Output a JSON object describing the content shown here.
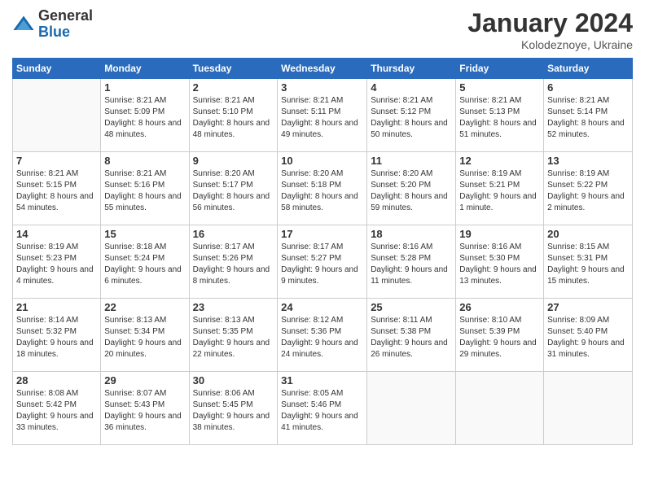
{
  "logo": {
    "general": "General",
    "blue": "Blue"
  },
  "header": {
    "month": "January 2024",
    "location": "Kolodeznoye, Ukraine"
  },
  "days_of_week": [
    "Sunday",
    "Monday",
    "Tuesday",
    "Wednesday",
    "Thursday",
    "Friday",
    "Saturday"
  ],
  "weeks": [
    [
      {
        "num": "",
        "sunrise": "",
        "sunset": "",
        "daylight": ""
      },
      {
        "num": "1",
        "sunrise": "Sunrise: 8:21 AM",
        "sunset": "Sunset: 5:09 PM",
        "daylight": "Daylight: 8 hours and 48 minutes."
      },
      {
        "num": "2",
        "sunrise": "Sunrise: 8:21 AM",
        "sunset": "Sunset: 5:10 PM",
        "daylight": "Daylight: 8 hours and 48 minutes."
      },
      {
        "num": "3",
        "sunrise": "Sunrise: 8:21 AM",
        "sunset": "Sunset: 5:11 PM",
        "daylight": "Daylight: 8 hours and 49 minutes."
      },
      {
        "num": "4",
        "sunrise": "Sunrise: 8:21 AM",
        "sunset": "Sunset: 5:12 PM",
        "daylight": "Daylight: 8 hours and 50 minutes."
      },
      {
        "num": "5",
        "sunrise": "Sunrise: 8:21 AM",
        "sunset": "Sunset: 5:13 PM",
        "daylight": "Daylight: 8 hours and 51 minutes."
      },
      {
        "num": "6",
        "sunrise": "Sunrise: 8:21 AM",
        "sunset": "Sunset: 5:14 PM",
        "daylight": "Daylight: 8 hours and 52 minutes."
      }
    ],
    [
      {
        "num": "7",
        "sunrise": "Sunrise: 8:21 AM",
        "sunset": "Sunset: 5:15 PM",
        "daylight": "Daylight: 8 hours and 54 minutes."
      },
      {
        "num": "8",
        "sunrise": "Sunrise: 8:21 AM",
        "sunset": "Sunset: 5:16 PM",
        "daylight": "Daylight: 8 hours and 55 minutes."
      },
      {
        "num": "9",
        "sunrise": "Sunrise: 8:20 AM",
        "sunset": "Sunset: 5:17 PM",
        "daylight": "Daylight: 8 hours and 56 minutes."
      },
      {
        "num": "10",
        "sunrise": "Sunrise: 8:20 AM",
        "sunset": "Sunset: 5:18 PM",
        "daylight": "Daylight: 8 hours and 58 minutes."
      },
      {
        "num": "11",
        "sunrise": "Sunrise: 8:20 AM",
        "sunset": "Sunset: 5:20 PM",
        "daylight": "Daylight: 8 hours and 59 minutes."
      },
      {
        "num": "12",
        "sunrise": "Sunrise: 8:19 AM",
        "sunset": "Sunset: 5:21 PM",
        "daylight": "Daylight: 9 hours and 1 minute."
      },
      {
        "num": "13",
        "sunrise": "Sunrise: 8:19 AM",
        "sunset": "Sunset: 5:22 PM",
        "daylight": "Daylight: 9 hours and 2 minutes."
      }
    ],
    [
      {
        "num": "14",
        "sunrise": "Sunrise: 8:19 AM",
        "sunset": "Sunset: 5:23 PM",
        "daylight": "Daylight: 9 hours and 4 minutes."
      },
      {
        "num": "15",
        "sunrise": "Sunrise: 8:18 AM",
        "sunset": "Sunset: 5:24 PM",
        "daylight": "Daylight: 9 hours and 6 minutes."
      },
      {
        "num": "16",
        "sunrise": "Sunrise: 8:17 AM",
        "sunset": "Sunset: 5:26 PM",
        "daylight": "Daylight: 9 hours and 8 minutes."
      },
      {
        "num": "17",
        "sunrise": "Sunrise: 8:17 AM",
        "sunset": "Sunset: 5:27 PM",
        "daylight": "Daylight: 9 hours and 9 minutes."
      },
      {
        "num": "18",
        "sunrise": "Sunrise: 8:16 AM",
        "sunset": "Sunset: 5:28 PM",
        "daylight": "Daylight: 9 hours and 11 minutes."
      },
      {
        "num": "19",
        "sunrise": "Sunrise: 8:16 AM",
        "sunset": "Sunset: 5:30 PM",
        "daylight": "Daylight: 9 hours and 13 minutes."
      },
      {
        "num": "20",
        "sunrise": "Sunrise: 8:15 AM",
        "sunset": "Sunset: 5:31 PM",
        "daylight": "Daylight: 9 hours and 15 minutes."
      }
    ],
    [
      {
        "num": "21",
        "sunrise": "Sunrise: 8:14 AM",
        "sunset": "Sunset: 5:32 PM",
        "daylight": "Daylight: 9 hours and 18 minutes."
      },
      {
        "num": "22",
        "sunrise": "Sunrise: 8:13 AM",
        "sunset": "Sunset: 5:34 PM",
        "daylight": "Daylight: 9 hours and 20 minutes."
      },
      {
        "num": "23",
        "sunrise": "Sunrise: 8:13 AM",
        "sunset": "Sunset: 5:35 PM",
        "daylight": "Daylight: 9 hours and 22 minutes."
      },
      {
        "num": "24",
        "sunrise": "Sunrise: 8:12 AM",
        "sunset": "Sunset: 5:36 PM",
        "daylight": "Daylight: 9 hours and 24 minutes."
      },
      {
        "num": "25",
        "sunrise": "Sunrise: 8:11 AM",
        "sunset": "Sunset: 5:38 PM",
        "daylight": "Daylight: 9 hours and 26 minutes."
      },
      {
        "num": "26",
        "sunrise": "Sunrise: 8:10 AM",
        "sunset": "Sunset: 5:39 PM",
        "daylight": "Daylight: 9 hours and 29 minutes."
      },
      {
        "num": "27",
        "sunrise": "Sunrise: 8:09 AM",
        "sunset": "Sunset: 5:40 PM",
        "daylight": "Daylight: 9 hours and 31 minutes."
      }
    ],
    [
      {
        "num": "28",
        "sunrise": "Sunrise: 8:08 AM",
        "sunset": "Sunset: 5:42 PM",
        "daylight": "Daylight: 9 hours and 33 minutes."
      },
      {
        "num": "29",
        "sunrise": "Sunrise: 8:07 AM",
        "sunset": "Sunset: 5:43 PM",
        "daylight": "Daylight: 9 hours and 36 minutes."
      },
      {
        "num": "30",
        "sunrise": "Sunrise: 8:06 AM",
        "sunset": "Sunset: 5:45 PM",
        "daylight": "Daylight: 9 hours and 38 minutes."
      },
      {
        "num": "31",
        "sunrise": "Sunrise: 8:05 AM",
        "sunset": "Sunset: 5:46 PM",
        "daylight": "Daylight: 9 hours and 41 minutes."
      },
      {
        "num": "",
        "sunrise": "",
        "sunset": "",
        "daylight": ""
      },
      {
        "num": "",
        "sunrise": "",
        "sunset": "",
        "daylight": ""
      },
      {
        "num": "",
        "sunrise": "",
        "sunset": "",
        "daylight": ""
      }
    ]
  ]
}
